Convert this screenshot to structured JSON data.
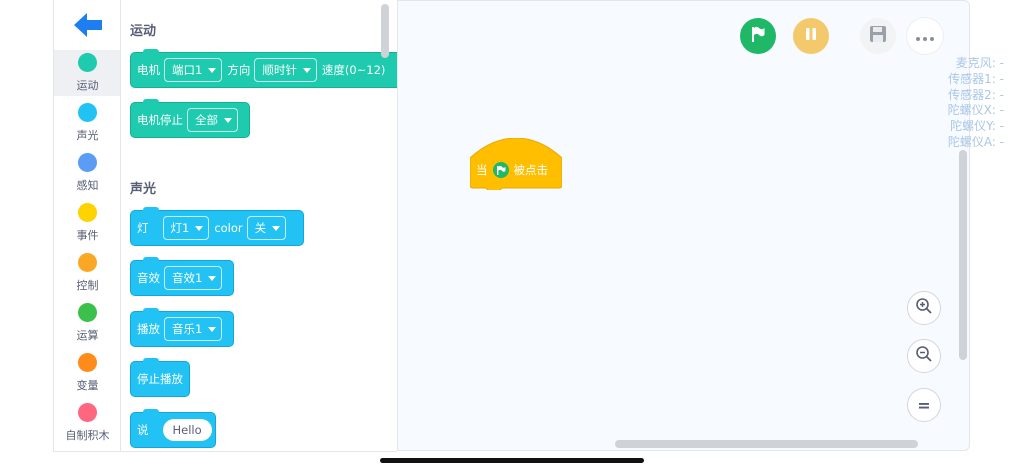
{
  "rail": {
    "categories": [
      {
        "label": "运动",
        "color": "#1ecbae"
      },
      {
        "label": "声光",
        "color": "#22c2f5"
      },
      {
        "label": "感知",
        "color": "#5b9cf4"
      },
      {
        "label": "事件",
        "color": "#ffd300"
      },
      {
        "label": "控制",
        "color": "#f9a825"
      },
      {
        "label": "运算",
        "color": "#3bc04b"
      },
      {
        "label": "变量",
        "color": "#ff8c1a"
      },
      {
        "label": "自制积木",
        "color": "#ff6680"
      }
    ]
  },
  "palette": {
    "motion_title": "运动",
    "sound_title": "声光",
    "motor": {
      "label": "电机",
      "port": "端口1",
      "dir_label": "方向",
      "dir": "顺时针",
      "speed_label": "速度(0~12)"
    },
    "motor_stop": {
      "label": "电机停止",
      "target": "全部"
    },
    "light": {
      "label": "灯",
      "light": "灯1",
      "color_label": "color",
      "state": "关"
    },
    "sfx": {
      "label": "音效",
      "value": "音效1"
    },
    "play": {
      "label": "播放",
      "value": "音乐1"
    },
    "stop_play": {
      "label": "停止播放"
    },
    "say": {
      "label": "说",
      "value": "Hello"
    }
  },
  "workspace": {
    "hat": {
      "prefix": "当",
      "suffix": "被点击"
    },
    "sensors": [
      "麦克风: -",
      "传感器1: -",
      "传感器2: -",
      "陀螺仪X: -",
      "陀螺仪Y: -",
      "陀螺仪A: -"
    ],
    "zoom_reset_label": "="
  }
}
